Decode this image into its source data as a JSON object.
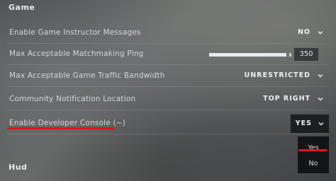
{
  "sections": {
    "game": "Game",
    "hud": "Hud"
  },
  "settings": [
    {
      "label": "Enable Game Instructor Messages",
      "value": "NO"
    },
    {
      "label": "Max Acceptable Matchmaking Ping",
      "value": "350",
      "slider_fraction": 0.97
    },
    {
      "label": "Max Acceptable Game Traffic Bandwidth",
      "value": "UNRESTRICTED"
    },
    {
      "label": "Community Notification Location",
      "value": "TOP RIGHT"
    },
    {
      "label": "Enable Developer Console (~)",
      "value": "YES"
    }
  ],
  "dropdown_options": [
    "Yes",
    "No"
  ],
  "colors": {
    "highlight_underline": "#e0141c",
    "text": "#d9dcdf"
  },
  "icons": {
    "dropdown": "chevron-down-icon"
  }
}
